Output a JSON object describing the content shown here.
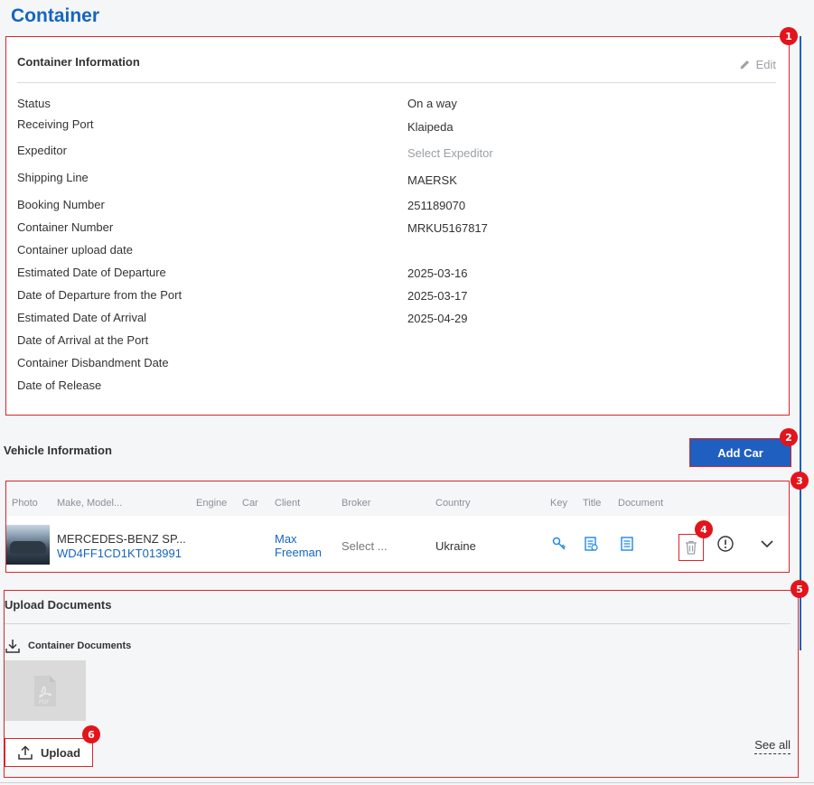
{
  "page": {
    "title": "Container"
  },
  "badges": [
    "1",
    "2",
    "3",
    "4",
    "5",
    "6"
  ],
  "container_info": {
    "title": "Container Information",
    "edit_label": "Edit",
    "rows": [
      {
        "label": "Status",
        "value": "On a way",
        "placeholder": false
      },
      {
        "label": "Receiving Port",
        "value": "Klaipeda",
        "placeholder": false
      },
      {
        "label": "Expeditor",
        "value": "Select Expeditor",
        "placeholder": true
      },
      {
        "label": "Shipping Line",
        "value": "MAERSK",
        "placeholder": false
      },
      {
        "label": "Booking Number",
        "value": "251189070",
        "placeholder": false
      },
      {
        "label": "Container Number",
        "value": "MRKU5167817",
        "placeholder": false
      },
      {
        "label": "Container upload date",
        "value": "",
        "placeholder": false
      },
      {
        "label": "Estimated Date of Departure",
        "value": "2025-03-16",
        "placeholder": false
      },
      {
        "label": "Date of Departure from the Port",
        "value": "2025-03-17",
        "placeholder": false
      },
      {
        "label": "Estimated Date of Arrival",
        "value": "2025-04-29",
        "placeholder": false
      },
      {
        "label": "Date of Arrival at the Port",
        "value": "",
        "placeholder": false
      },
      {
        "label": "Container Disbandment Date",
        "value": "",
        "placeholder": false
      },
      {
        "label": "Date of Release",
        "value": "",
        "placeholder": false
      }
    ]
  },
  "vehicle": {
    "title": "Vehicle Information",
    "add_car_label": "Add Car",
    "columns": [
      "Photo",
      "Make, Model...",
      "Engine",
      "Car",
      "Client",
      "Broker",
      "Country",
      "Key",
      "Title",
      "Document"
    ],
    "row": {
      "make": "MERCEDES-BENZ SP...",
      "vin": "WD4FF1CD1KT013991",
      "client_first": "Max",
      "client_last": "Freeman",
      "broker_placeholder": "Select ...",
      "country": "Ukraine"
    }
  },
  "upload": {
    "title": "Upload Documents",
    "container_docs_label": "Container Documents",
    "pdf_label": "PDF",
    "upload_label": "Upload",
    "see_all_label": "See all"
  },
  "colors": {
    "accent": "#1f5fbf",
    "title_blue": "#1565c0",
    "annotation_red": "#e3141c"
  }
}
